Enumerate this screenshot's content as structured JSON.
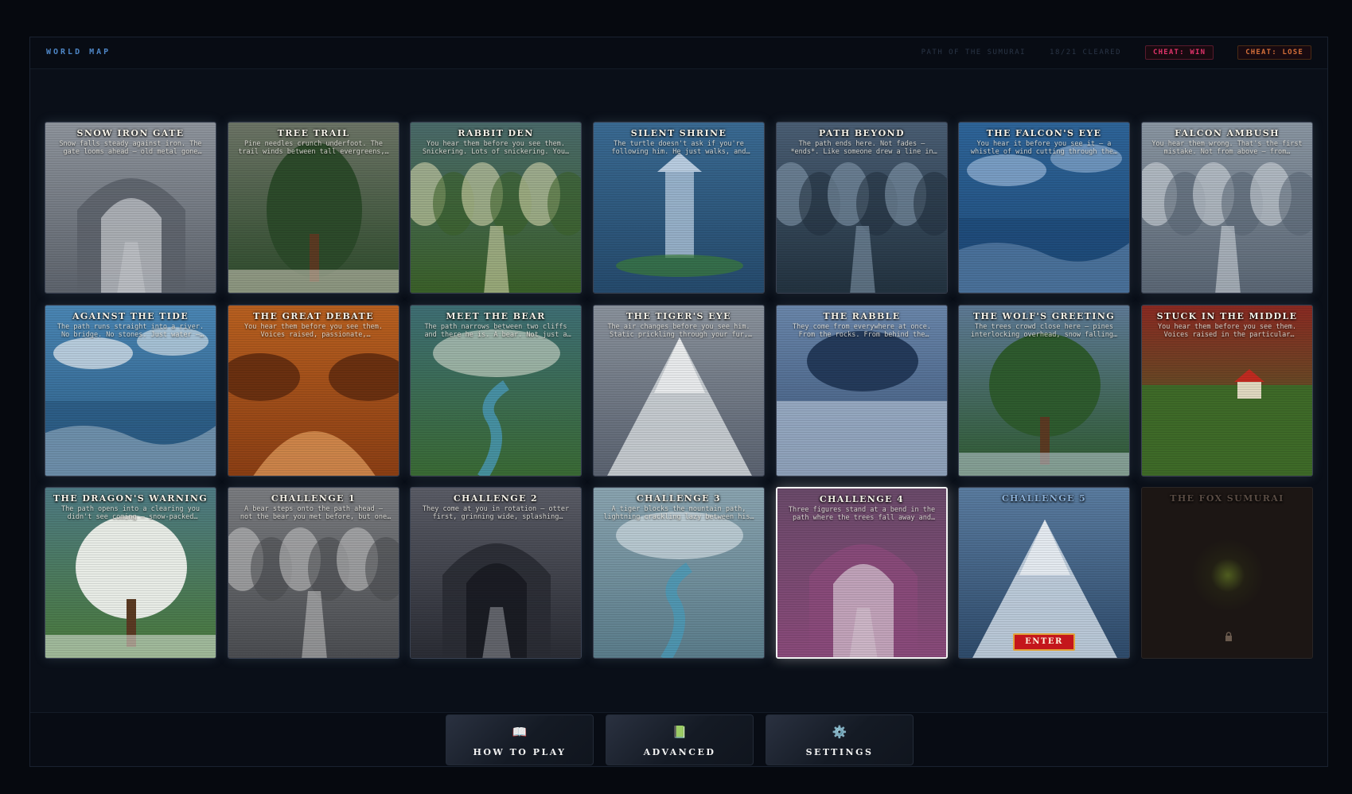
{
  "header": {
    "title": "WORLD MAP",
    "path_label": "PATH OF THE SUMURAI",
    "progress": "18/21 CLEARED",
    "cheat_win": "CHEAT: WIN",
    "cheat_lose": "CHEAT: LOSE"
  },
  "cards": [
    {
      "title": "SNOW IRON GATE",
      "desc": "Snow falls steady against iron. The gate looms ahead — old metal gone gray…",
      "theme": "gate",
      "colors": [
        "#8e949c",
        "#5d636c",
        "#c9ccd0"
      ]
    },
    {
      "title": "TREE TRAIL",
      "desc": "Pine needles crunch underfoot. The trail winds between tall evergreens,…",
      "theme": "tree",
      "colors": [
        "#6c7466",
        "#2c4a2a",
        "#d8d4c4"
      ]
    },
    {
      "title": "RABBIT DEN",
      "desc": "You hear them before you see them. Snickering. Lots of snickering. You…",
      "theme": "forest",
      "colors": [
        "#4a6a6a",
        "#3a6028",
        "#e4e2b8"
      ]
    },
    {
      "title": "SILENT SHRINE",
      "desc": "The turtle doesn't ask if you're following him. He just walks, and you…",
      "theme": "shrine",
      "colors": [
        "#3a6a92",
        "#254a6c",
        "#b8cce0"
      ]
    },
    {
      "title": "PATH BEYOND",
      "desc": "The path ends here. Not fades — *ends*. Like someone drew a line in the snow…",
      "theme": "path",
      "colors": [
        "#4a5e74",
        "#22323f",
        "#8aa0b4"
      ]
    },
    {
      "title": "THE FALCON'S EYE",
      "desc": "You hear it before you see it — a whistle of wind cutting through the…",
      "theme": "sky",
      "colors": [
        "#2e6498",
        "#1e4a78",
        "#9ab8d8"
      ]
    },
    {
      "title": "FALCON AMBUSH",
      "desc": "You hear them wrong. That's the first mistake. Not from above — from…",
      "theme": "snowforest",
      "colors": [
        "#8a96a2",
        "#5a6674",
        "#d8dee4"
      ]
    },
    {
      "title": "AGAINST THE TIDE",
      "desc": "The path runs straight into a river. No bridge. No stones. Just water — cold,…",
      "theme": "sea",
      "colors": [
        "#4a86b4",
        "#2a5a82",
        "#e8eef2"
      ]
    },
    {
      "title": "THE GREAT DEBATE",
      "desc": "You hear them before you see them. Voices raised, passionate, completely…",
      "theme": "autumn",
      "colors": [
        "#b86020",
        "#8a3e14",
        "#e6a060"
      ]
    },
    {
      "title": "MEET THE BEAR",
      "desc": "The path narrows between two cliffs and there he is. A bear. Not just a bear —…",
      "theme": "river",
      "colors": [
        "#3e6e74",
        "#3a6a34",
        "#d8e0d2"
      ]
    },
    {
      "title": "THE TIGER'S EYE",
      "desc": "The air changes before you see him. Static prickling through your fur, the…",
      "theme": "mountain",
      "colors": [
        "#8a929c",
        "#5a6270",
        "#d4d8dc"
      ]
    },
    {
      "title": "THE RABBLE",
      "desc": "They come from everywhere at once. From the rocks. From behind the trees. From…",
      "theme": "cave-snow",
      "colors": [
        "#6a86aa",
        "#3a5478",
        "#c4d2e2"
      ]
    },
    {
      "title": "THE WOLF'S GREETING",
      "desc": "The trees crowd close here — pines interlocking overhead, snow falling…",
      "theme": "bigtree",
      "colors": [
        "#5e7a96",
        "#2e5a2e",
        "#c8d6e2"
      ]
    },
    {
      "title": "STUCK IN THE MIDDLE",
      "desc": "You hear them before you see them. Voices raised in the particular cadence…",
      "theme": "village",
      "colors": [
        "#8a2a22",
        "#3e6a28",
        "#d8d0b8"
      ]
    },
    {
      "title": "THE DRAGON'S WARNING",
      "desc": "The path opens into a clearing you didn't see coming — snow-packed earth,…",
      "theme": "blossom",
      "colors": [
        "#4e7a84",
        "#4a7a3a",
        "#e8ece6"
      ]
    },
    {
      "title": "CHALLENGE 1",
      "desc": "A bear steps onto the path ahead — not the bear you met before, but one cut…",
      "theme": "greyforest",
      "colors": [
        "#7a7c80",
        "#4a4c50",
        "#c8c8c8"
      ]
    },
    {
      "title": "CHALLENGE 2",
      "desc": "They come at you in rotation — otter first, grinning wide, splashing throug…",
      "theme": "cave",
      "colors": [
        "#5a5c66",
        "#2a2c34",
        "#a8aab2"
      ]
    },
    {
      "title": "CHALLENGE 3",
      "desc": "A tiger blocks the mountain path, lightning crackling lazy between his…",
      "theme": "lake",
      "colors": [
        "#8aa4b0",
        "#5a7c8a",
        "#e0e8ec"
      ]
    },
    {
      "title": "CHALLENGE 4",
      "desc": "Three figures stand at a bend in the path where the trees fall away and the…",
      "theme": "purple",
      "colors": [
        "#6a4a6a",
        "#8a4a7a",
        "#d8c8d4"
      ]
    },
    {
      "title": "CHALLENGE 5",
      "desc": "",
      "theme": "peak",
      "colors": [
        "#5a7ca0",
        "#2e4a6a",
        "#d0dce8"
      ]
    },
    {
      "title": "THE FOX SUMURAI",
      "desc": "",
      "theme": "locked",
      "colors": [
        "#1c1614",
        "#2a1e18",
        "#5a4c44"
      ]
    }
  ],
  "enter_label": "ENTER",
  "footer": {
    "how_to_play": {
      "label": "HOW TO PLAY",
      "icon": "📖"
    },
    "advanced": {
      "label": "ADVANCED",
      "icon": "📗"
    },
    "settings": {
      "label": "SETTINGS",
      "icon": "⚙️"
    }
  }
}
